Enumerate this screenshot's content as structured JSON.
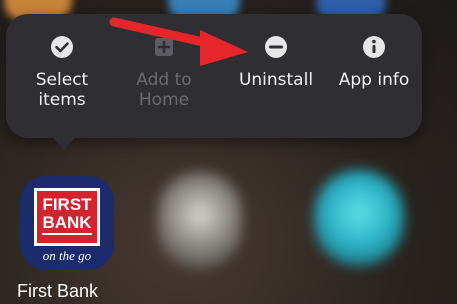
{
  "context_menu": {
    "actions": [
      {
        "label": "Select\nitems",
        "icon": "check-circle-icon",
        "enabled": true
      },
      {
        "label": "Add to\nHome",
        "icon": "add-home-icon",
        "enabled": false
      },
      {
        "label": "Uninstall",
        "icon": "minus-circle-icon",
        "enabled": true
      },
      {
        "label": "App info",
        "icon": "info-icon",
        "enabled": true
      }
    ]
  },
  "app": {
    "name": "First Bank",
    "logo_line1": "FIRST",
    "logo_line2": "BANK",
    "tagline": "on the go"
  },
  "colors": {
    "popup_bg": "#2f2f33",
    "annotation_arrow": "#e5272b",
    "bank_blue": "#1b2b6b",
    "bank_red": "#d3232f"
  }
}
